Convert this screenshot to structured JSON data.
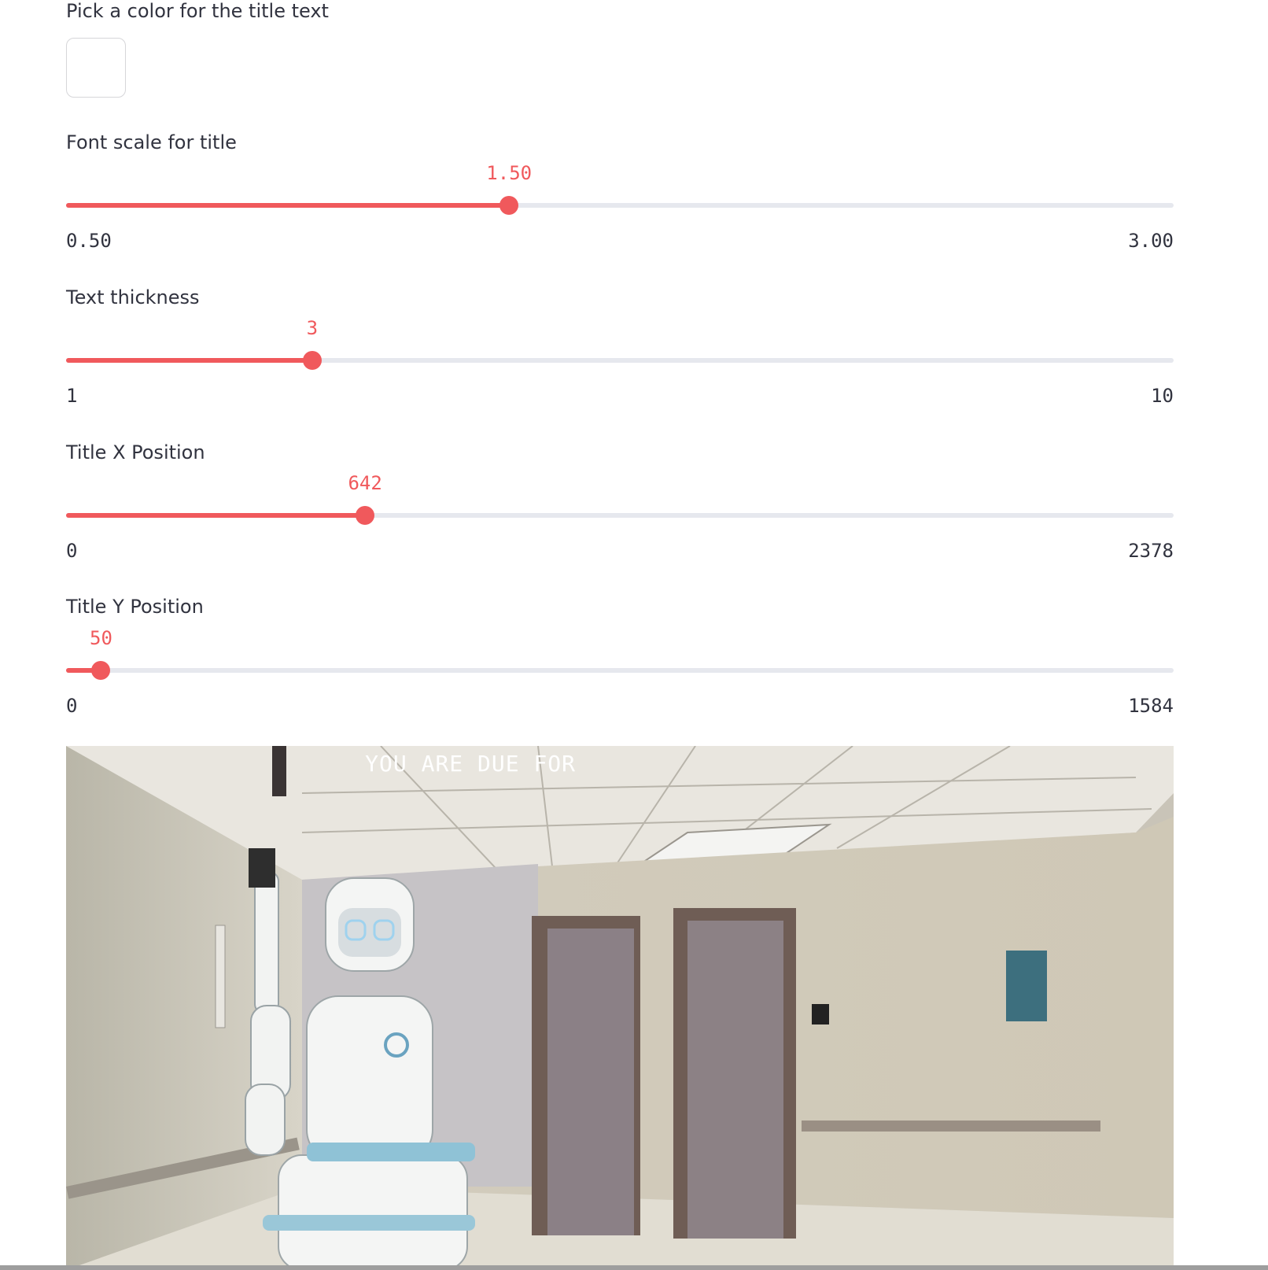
{
  "color_picker": {
    "label": "Pick a color for the title text",
    "value": "#ffffff"
  },
  "sliders": [
    {
      "label": "Font scale for title",
      "value": "1.50",
      "min": "0.50",
      "max": "3.00",
      "fraction": 0.4
    },
    {
      "label": "Text thickness",
      "value": "3",
      "min": "1",
      "max": "10",
      "fraction": 0.2222
    },
    {
      "label": "Title X Position",
      "value": "642",
      "min": "0",
      "max": "2378",
      "fraction": 0.27
    },
    {
      "label": "Title Y Position",
      "value": "50",
      "min": "0",
      "max": "1584",
      "fraction": 0.0316
    }
  ],
  "image": {
    "overlay_text": "YOU ARE DUE FOR"
  },
  "colors": {
    "accent": "#f0595c",
    "track": "#e6e8ee",
    "text": "#31333f"
  }
}
